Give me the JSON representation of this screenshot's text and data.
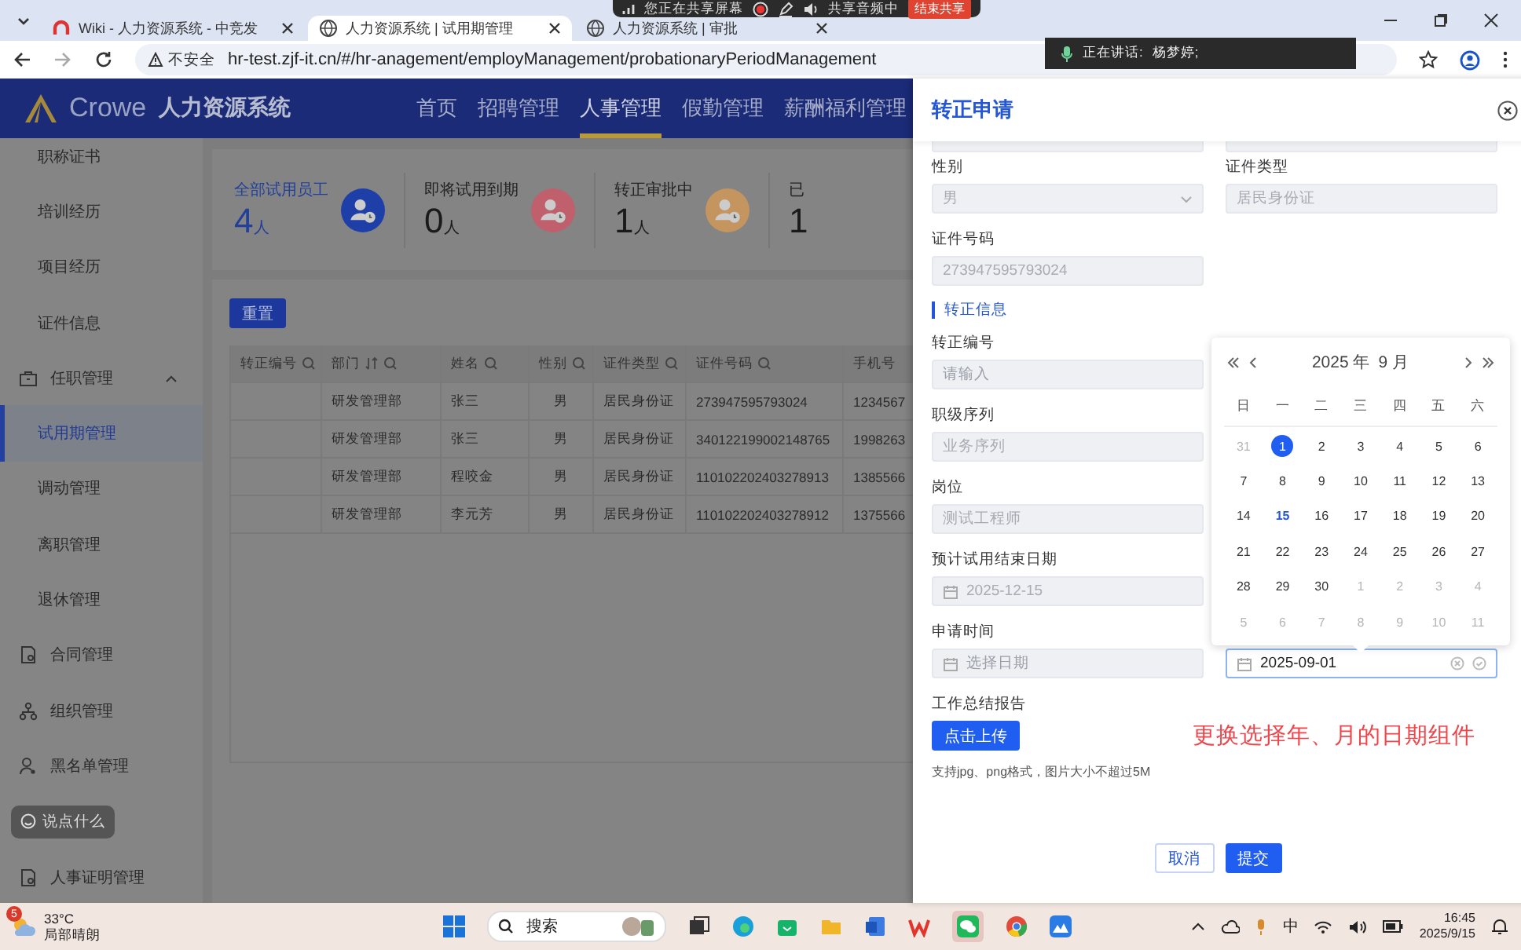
{
  "browser": {
    "tabs": [
      {
        "title": "Wiki - 人力资源系统 - 中竞发",
        "selected": false
      },
      {
        "title": "人力资源系统 | 试用期管理",
        "selected": true
      },
      {
        "title": "人力资源系统 | 审批",
        "selected": false
      }
    ],
    "security": "不安全",
    "url": "hr-test.zjf-it.cn/#/hr-anagement/employManagement/probationaryPeriodManagement"
  },
  "share_bar": {
    "status": "您正在共享屏幕",
    "audio": "共享音频中",
    "stop": "结束共享"
  },
  "speaking": {
    "label": "正在讲话:",
    "name": "杨梦婷;"
  },
  "app": {
    "logo": "Crowe",
    "system": "人力资源系统",
    "nav": [
      {
        "label": "首页",
        "selected": false
      },
      {
        "label": "招聘管理",
        "selected": false
      },
      {
        "label": "人事管理",
        "selected": true
      },
      {
        "label": "假勤管理",
        "selected": false
      },
      {
        "label": "薪酬福利管理",
        "selected": false
      }
    ]
  },
  "sidebar": [
    {
      "label": "职称证书",
      "kind": "sub",
      "selected": false
    },
    {
      "label": "培训经历",
      "kind": "sub",
      "selected": false
    },
    {
      "label": "项目经历",
      "kind": "sub",
      "selected": false
    },
    {
      "label": "证件信息",
      "kind": "sub",
      "selected": false
    },
    {
      "label": "任职管理",
      "kind": "group",
      "expanded": true
    },
    {
      "label": "试用期管理",
      "kind": "sub",
      "selected": true
    },
    {
      "label": "调动管理",
      "kind": "sub",
      "selected": false
    },
    {
      "label": "离职管理",
      "kind": "sub",
      "selected": false
    },
    {
      "label": "退休管理",
      "kind": "sub",
      "selected": false
    },
    {
      "label": "合同管理",
      "kind": "group",
      "expanded": false
    },
    {
      "label": "组织管理",
      "kind": "group",
      "expanded": false
    },
    {
      "label": "黑名单管理",
      "kind": "group",
      "expanded": false
    },
    {
      "label": "说点什么",
      "kind": "chip"
    },
    {
      "label": "人事证明管理",
      "kind": "group",
      "expanded": false
    }
  ],
  "stats": [
    {
      "label": "全部试用员工",
      "count": "4",
      "unit": "人",
      "selected": true,
      "color": "#1f3fa8"
    },
    {
      "label": "即将试用到期",
      "count": "0",
      "unit": "人",
      "selected": false,
      "color": "#c0606c"
    },
    {
      "label": "转正审批中",
      "count": "1",
      "unit": "人",
      "selected": false,
      "color": "#c4955f"
    },
    {
      "label": "已",
      "count": "1",
      "selected": false
    }
  ],
  "reset_button": "重置",
  "table": {
    "columns": [
      "转正编号",
      "部门",
      "姓名",
      "性别",
      "证件类型",
      "证件号码",
      "手机号"
    ],
    "rows": [
      [
        "",
        "研发管理部",
        "张三",
        "男",
        "居民身份证",
        "273947595793024",
        "1234567"
      ],
      [
        "",
        "研发管理部",
        "张三",
        "男",
        "居民身份证",
        "340122199002148765",
        "1998263"
      ],
      [
        "",
        "研发管理部",
        "程咬金",
        "男",
        "居民身份证",
        "110102202403278913",
        "1385566"
      ],
      [
        "",
        "研发管理部",
        "李元芳",
        "男",
        "居民身份证",
        "110102202403278912",
        "1375566"
      ]
    ]
  },
  "drawer": {
    "title": "转正申请",
    "top_rows": [
      [
        {
          "label": "性别",
          "value": "男",
          "kind": "select",
          "disabled": true,
          "focused": false
        },
        {
          "label": "证件类型",
          "value": "居民身份证",
          "kind": "text",
          "disabled": true,
          "focused": false
        }
      ],
      [
        {
          "label": "证件号码",
          "value": "273947595793024",
          "kind": "text",
          "disabled": true,
          "focused": false
        }
      ]
    ],
    "section": "转正信息",
    "bottom_rows": [
      [
        {
          "label": "转正编号",
          "placeholder": "请输入",
          "kind": "text",
          "disabled": true,
          "focused": false
        }
      ],
      [
        {
          "label": "职级序列",
          "value": "业务序列",
          "kind": "text",
          "disabled": true,
          "focused": false
        }
      ],
      [
        {
          "label": "岗位",
          "value": "测试工程师",
          "kind": "text",
          "disabled": true,
          "focused": false
        }
      ],
      [
        {
          "label": "预计试用结束日期",
          "value": "2025-12-15",
          "kind": "date",
          "disabled": true,
          "focused": false
        }
      ],
      [
        {
          "label": "申请时间",
          "placeholder": "选择日期",
          "kind": "date",
          "disabled": true,
          "focused": false
        },
        {
          "value": "2025-09-01",
          "kind": "date",
          "disabled": false,
          "focused": true
        }
      ]
    ],
    "upload_label": "工作总结报告",
    "upload_button": "点击上传",
    "upload_hint": "支持jpg、png格式，图片大小不超过5M",
    "annotation": "更换选择年、月的日期组件",
    "cancel": "取消",
    "submit": "提交",
    "calendar": {
      "year": "2025 年",
      "month": "9 月",
      "weekdays": [
        "日",
        "一",
        "二",
        "三",
        "四",
        "五",
        "六"
      ],
      "days": [
        {
          "day": "31",
          "other_month": true,
          "selected": false,
          "today": false
        },
        {
          "day": "1",
          "other_month": false,
          "selected": true,
          "today": false
        },
        {
          "day": "2",
          "other_month": false,
          "selected": false,
          "today": false
        },
        {
          "day": "3",
          "other_month": false,
          "selected": false,
          "today": false
        },
        {
          "day": "4",
          "other_month": false,
          "selected": false,
          "today": false
        },
        {
          "day": "5",
          "other_month": false,
          "selected": false,
          "today": false
        },
        {
          "day": "6",
          "other_month": false,
          "selected": false,
          "today": false
        },
        {
          "day": "7",
          "other_month": false,
          "selected": false,
          "today": false
        },
        {
          "day": "8",
          "other_month": false,
          "selected": false,
          "today": false
        },
        {
          "day": "9",
          "other_month": false,
          "selected": false,
          "today": false
        },
        {
          "day": "10",
          "other_month": false,
          "selected": false,
          "today": false
        },
        {
          "day": "11",
          "other_month": false,
          "selected": false,
          "today": false
        },
        {
          "day": "12",
          "other_month": false,
          "selected": false,
          "today": false
        },
        {
          "day": "13",
          "other_month": false,
          "selected": false,
          "today": false
        },
        {
          "day": "14",
          "other_month": false,
          "selected": false,
          "today": false
        },
        {
          "day": "15",
          "other_month": false,
          "selected": false,
          "today": true
        },
        {
          "day": "16",
          "other_month": false,
          "selected": false,
          "today": false
        },
        {
          "day": "17",
          "other_month": false,
          "selected": false,
          "today": false
        },
        {
          "day": "18",
          "other_month": false,
          "selected": false,
          "today": false
        },
        {
          "day": "19",
          "other_month": false,
          "selected": false,
          "today": false
        },
        {
          "day": "20",
          "other_month": false,
          "selected": false,
          "today": false
        },
        {
          "day": "21",
          "other_month": false,
          "selected": false,
          "today": false
        },
        {
          "day": "22",
          "other_month": false,
          "selected": false,
          "today": false
        },
        {
          "day": "23",
          "other_month": false,
          "selected": false,
          "today": false
        },
        {
          "day": "24",
          "other_month": false,
          "selected": false,
          "today": false
        },
        {
          "day": "25",
          "other_month": false,
          "selected": false,
          "today": false
        },
        {
          "day": "26",
          "other_month": false,
          "selected": false,
          "today": false
        },
        {
          "day": "27",
          "other_month": false,
          "selected": false,
          "today": false
        },
        {
          "day": "28",
          "other_month": false,
          "selected": false,
          "today": false
        },
        {
          "day": "29",
          "other_month": false,
          "selected": false,
          "today": false
        },
        {
          "day": "30",
          "other_month": false,
          "selected": false,
          "today": false
        },
        {
          "day": "1",
          "other_month": true,
          "selected": false,
          "today": false
        },
        {
          "day": "2",
          "other_month": true,
          "selected": false,
          "today": false
        },
        {
          "day": "3",
          "other_month": true,
          "selected": false,
          "today": false
        },
        {
          "day": "4",
          "other_month": true,
          "selected": false,
          "today": false
        },
        {
          "day": "5",
          "other_month": true,
          "selected": false,
          "today": false
        },
        {
          "day": "6",
          "other_month": true,
          "selected": false,
          "today": false
        },
        {
          "day": "7",
          "other_month": true,
          "selected": false,
          "today": false
        },
        {
          "day": "8",
          "other_month": true,
          "selected": false,
          "today": false
        },
        {
          "day": "9",
          "other_month": true,
          "selected": false,
          "today": false
        },
        {
          "day": "10",
          "other_month": true,
          "selected": false,
          "today": false
        },
        {
          "day": "11",
          "other_month": true,
          "selected": false,
          "today": false
        }
      ]
    }
  },
  "taskbar": {
    "badge": "5",
    "temperature": "33°C",
    "weather": "局部晴朗",
    "search": "搜索",
    "ime": "中",
    "time": "16:45",
    "date": "2025/9/15"
  }
}
